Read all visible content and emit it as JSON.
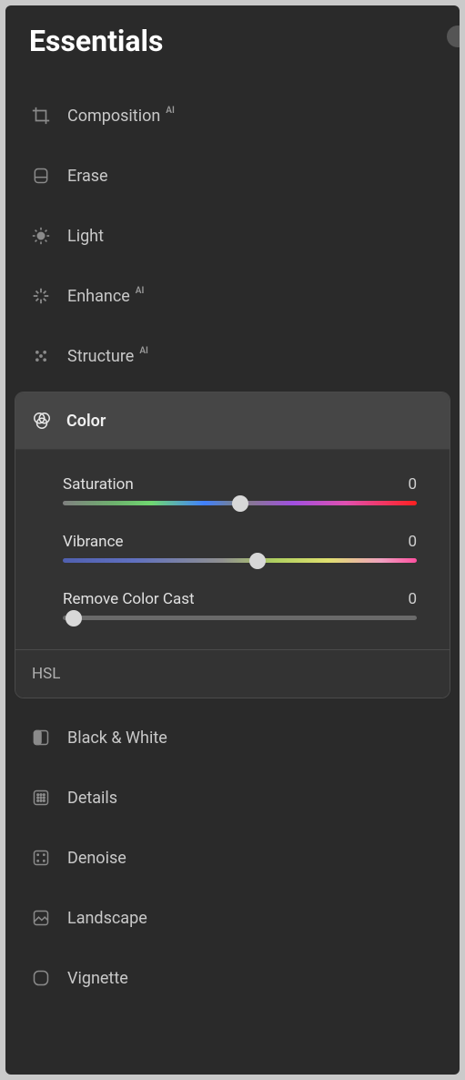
{
  "title": "Essentials",
  "ai_badge": "AI",
  "tools": {
    "composition": "Composition",
    "erase": "Erase",
    "light": "Light",
    "enhance": "Enhance",
    "structure": "Structure",
    "color": "Color",
    "black_white": "Black & White",
    "details": "Details",
    "denoise": "Denoise",
    "landscape": "Landscape",
    "vignette": "Vignette"
  },
  "color_panel": {
    "saturation": {
      "label": "Saturation",
      "value": "0",
      "pos": 50
    },
    "vibrance": {
      "label": "Vibrance",
      "value": "0",
      "pos": 55
    },
    "remove_cast": {
      "label": "Remove Color Cast",
      "value": "0",
      "pos": 3
    },
    "hsl": "HSL"
  }
}
